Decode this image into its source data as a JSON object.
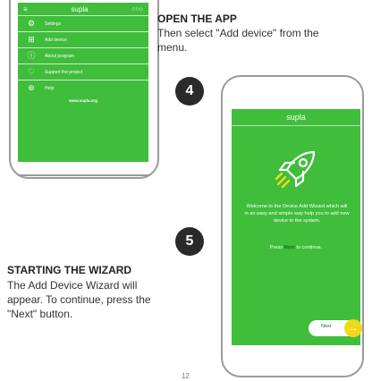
{
  "left_phone": {
    "brand": "supla",
    "menu": [
      {
        "icon": "gear-icon",
        "glyph": "⚙",
        "label": "Settings"
      },
      {
        "icon": "plus-square-icon",
        "glyph": "⊞",
        "label": "Add device"
      },
      {
        "icon": "info-icon",
        "glyph": "ⓘ",
        "label": "About program"
      },
      {
        "icon": "heart-icon",
        "glyph": "♡",
        "label": "Support the project"
      },
      {
        "icon": "help-icon",
        "glyph": "⊛",
        "label": "Help"
      }
    ],
    "website": "www.supla.org"
  },
  "step_open": {
    "heading": "OPEN THE APP",
    "text": "Then select \"Add device\" from the menu."
  },
  "step_numbers": {
    "four": "4",
    "five": "5"
  },
  "wizard_phone": {
    "brand": "supla",
    "welcome_text": "Welcome to the Device Add Wizard which will in an easy and simple way help you to add new device to the system.",
    "press_prefix": "Press",
    "press_keyword": "Next",
    "press_suffix": "to continue.",
    "next_label": "Next",
    "accent_color": "#3fbd3b",
    "next_arrow_color": "#f3d81a"
  },
  "step_wizard": {
    "heading": "STARTING THE WIZARD",
    "text": "The Add Device Wizard will appear. To continue, press the \"Next\" button."
  },
  "page_number": "12"
}
